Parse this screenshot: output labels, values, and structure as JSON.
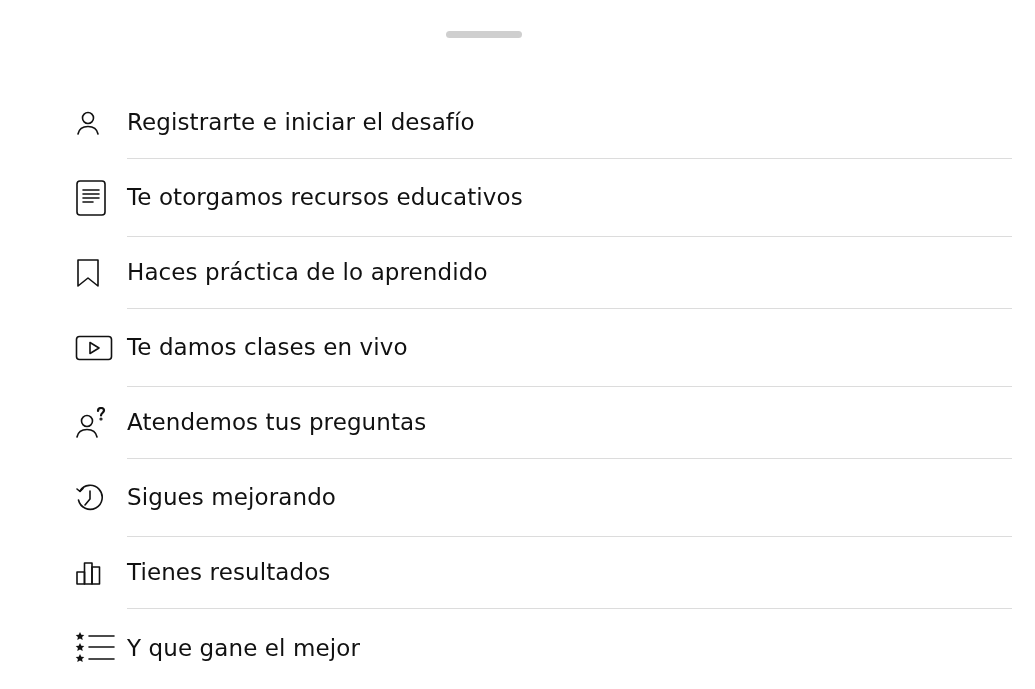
{
  "steps": [
    {
      "kind": "person",
      "label": "Registrarte e iniciar el desafío"
    },
    {
      "kind": "document",
      "label": "Te otorgamos recursos educativos"
    },
    {
      "kind": "bookmark",
      "label": "Haces práctica de lo aprendido"
    },
    {
      "kind": "video",
      "label": "Te damos clases en vivo"
    },
    {
      "kind": "question",
      "label": "Atendemos tus preguntas"
    },
    {
      "kind": "history",
      "label": "Sigues mejorando"
    },
    {
      "kind": "chart",
      "label": "Tienes resultados"
    },
    {
      "kind": "ranking",
      "label": "Y que gane el mejor"
    }
  ]
}
